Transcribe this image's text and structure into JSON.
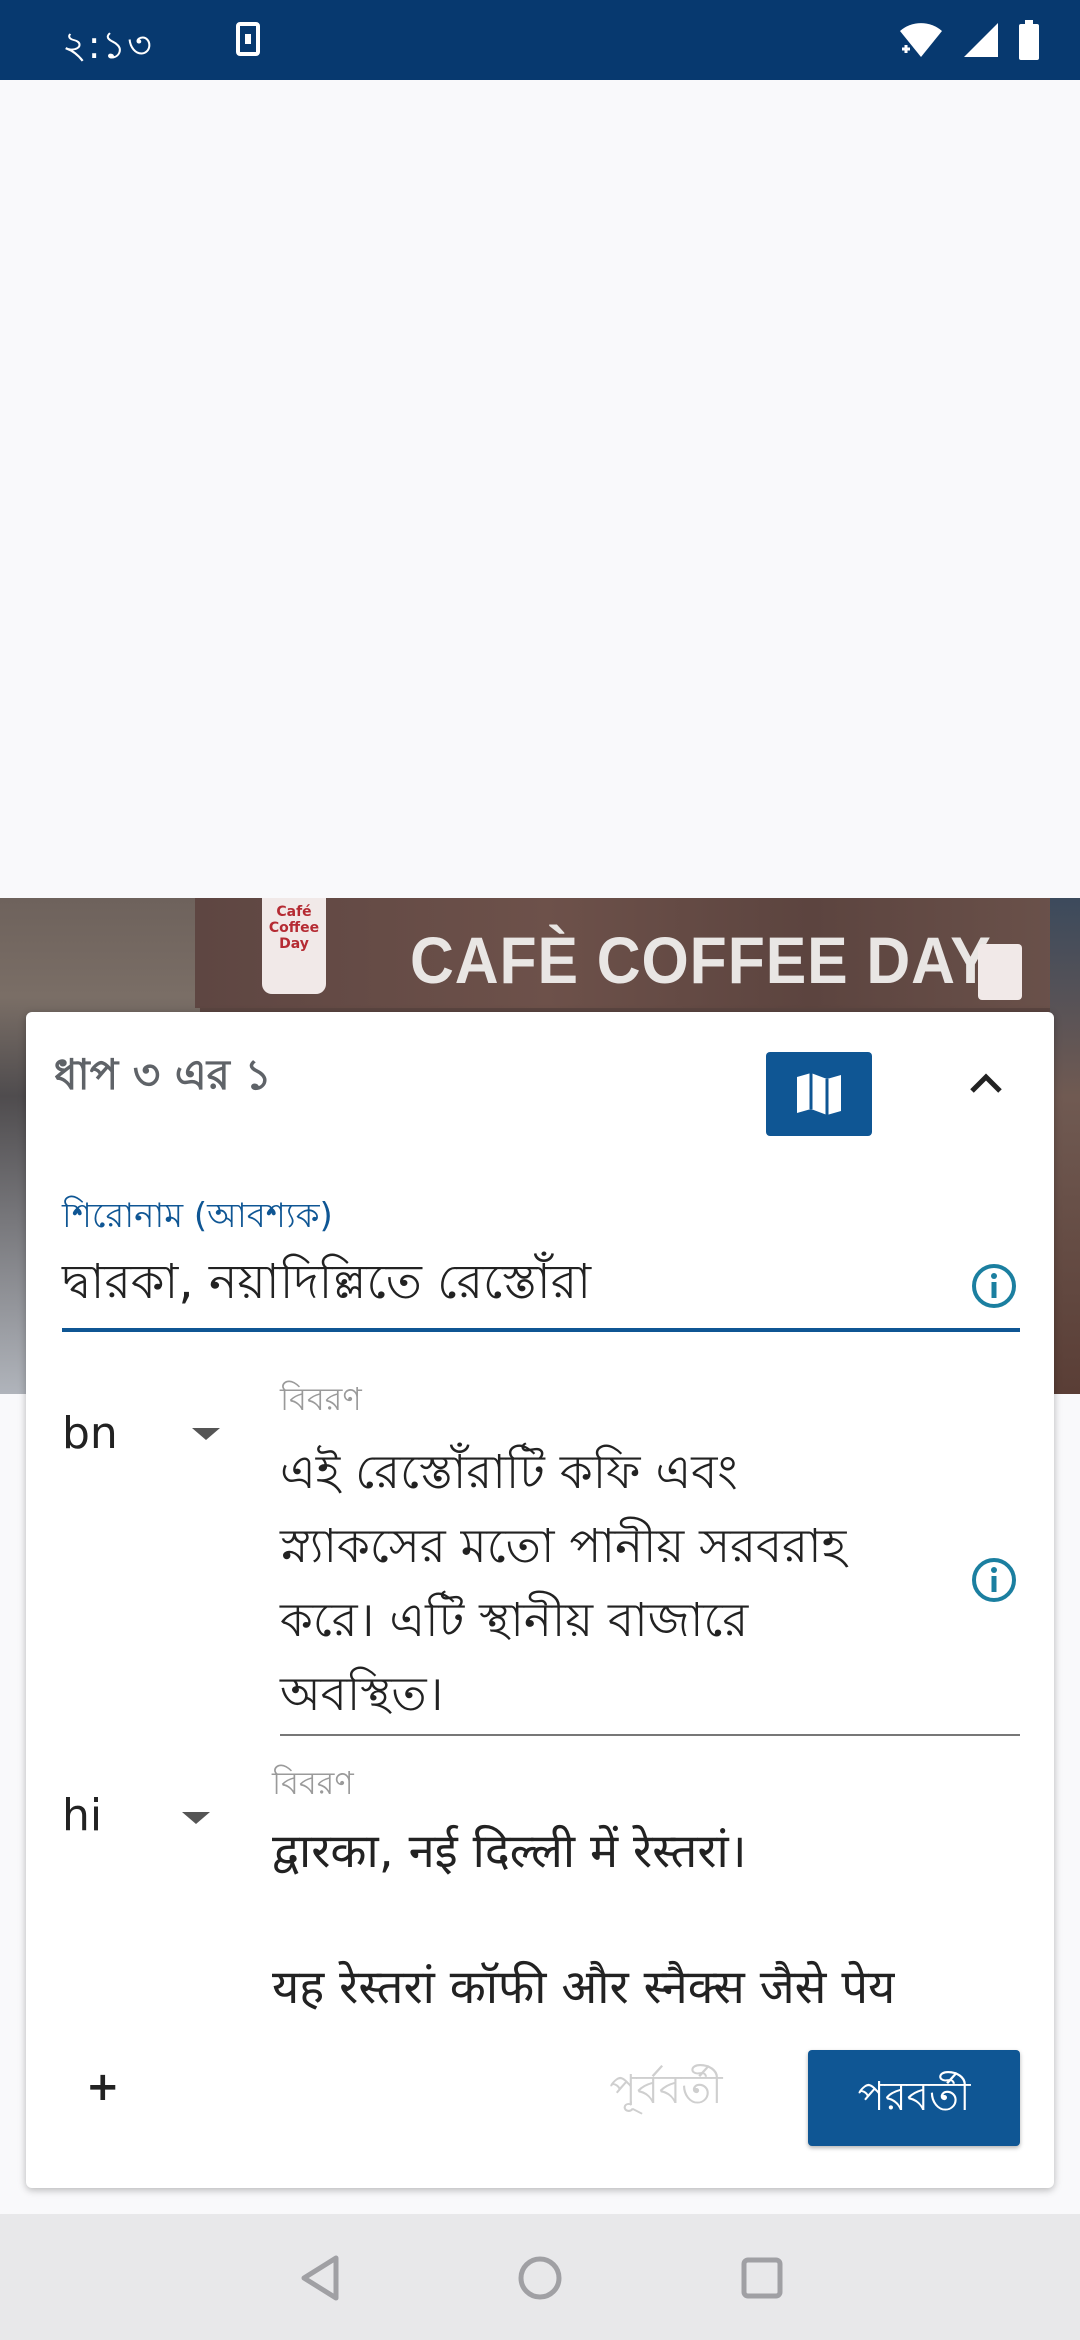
{
  "status_bar": {
    "time": "২:১৩",
    "icons": [
      "notification-download-icon",
      "wifi-icon",
      "signal-icon",
      "battery-icon"
    ],
    "background": "#07396f"
  },
  "photo": {
    "sign_text": "CAFÈ COFFEE DAY",
    "logo_text": "Café Coffee Day"
  },
  "card": {
    "step_label": "ধাপ ৩ এর ১",
    "map_icon": "map-icon",
    "collapse_icon": "chevron-up-icon",
    "title": {
      "label": "শিরোনাম (আবশ্যক)",
      "value": "দ্বারকা, নয়াদিল্লিতে রেস্তোঁরা"
    },
    "descriptions": [
      {
        "language": "bn",
        "label": "বিবরণ",
        "lines": [
          "এই রেস্তোঁরাটি কফি এবং",
          "স্ন্যাকসের মতো পানীয় সরবরাহ",
          "করে। এটি স্থানীয় বাজারে",
          "অবস্থিত।"
        ]
      },
      {
        "language": "hi",
        "label": "বিবরণ",
        "lines": [
          "द्वारका, नई दिल्ली में रेस्तरां।",
          "",
          "यह रेस्तरां कॉफी और स्नैक्स जैसे पेय"
        ]
      }
    ],
    "add_label": "+",
    "prev_label": "পূর্ববর্তী",
    "next_label": "পরবর্তী"
  },
  "colors": {
    "accent": "#0f5694",
    "info_icon": "#1b7fa0"
  },
  "nav_bar": {
    "icons": [
      "back-icon",
      "home-icon",
      "recents-icon"
    ]
  }
}
